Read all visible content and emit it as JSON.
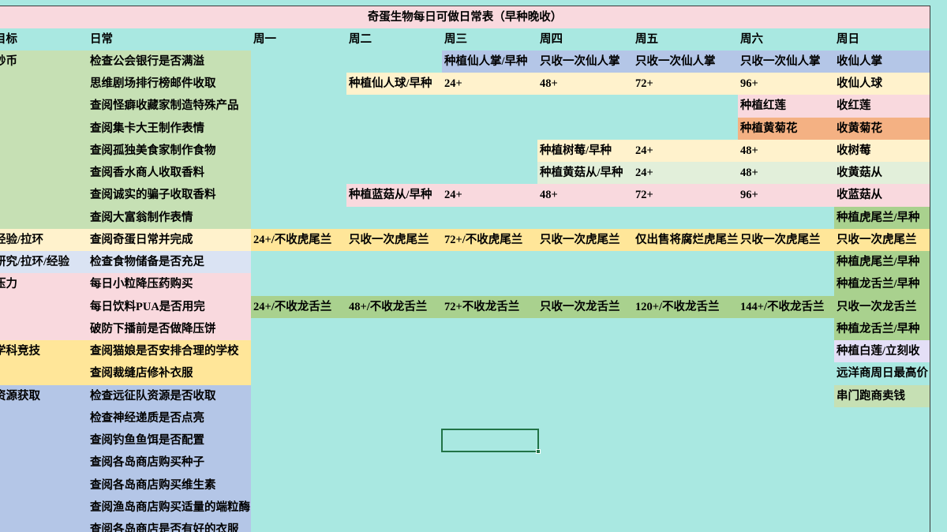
{
  "sheet": {
    "title": "奇蛋生物每日可做日常表（早种晚收）",
    "columns": {
      "goal": "目标",
      "task": "日常",
      "days": [
        "周一",
        "周二",
        "周三",
        "周四",
        "周五",
        "周六",
        "周日"
      ]
    },
    "colors": {
      "background": "#a9e8e1",
      "title_fill": "#f9d9de",
      "border": "#3a3a3a",
      "selection": "#217346"
    },
    "groups": [
      {
        "goal": "钞币",
        "fill": "#c6e0b4",
        "rows": [
          {
            "task": "检查公会银行是否满溢",
            "days": [
              null,
              null,
              {
                "text": "种植仙人掌/早种",
                "fill": "#b4c6e7"
              },
              {
                "text": "只收一次仙人掌",
                "fill": "#b4c6e7"
              },
              {
                "text": "只收一次仙人掌",
                "fill": "#b4c6e7"
              },
              {
                "text": "只收一次仙人掌",
                "fill": "#b4c6e7"
              },
              {
                "text": "收仙人掌",
                "fill": "#b4c6e7"
              }
            ]
          },
          {
            "task": "思维剧场排行榜邮件收取",
            "days": [
              null,
              {
                "text": "种植仙人球/早种",
                "fill": "#fff2cc"
              },
              {
                "text": "24+",
                "fill": "#fff2cc"
              },
              {
                "text": "48+",
                "fill": "#fff2cc"
              },
              {
                "text": "72+",
                "fill": "#fff2cc"
              },
              {
                "text": "96+",
                "fill": "#fff2cc"
              },
              {
                "text": "收仙人球",
                "fill": "#fff2cc"
              }
            ]
          },
          {
            "task": "查阅怪癖收藏家制造特殊产品",
            "days": [
              null,
              null,
              null,
              null,
              null,
              {
                "text": "种植红莲",
                "fill": "#f9d9de"
              },
              {
                "text": "收红莲",
                "fill": "#f9d9de"
              }
            ]
          },
          {
            "task": "查阅集卡大王制作表情",
            "days": [
              null,
              null,
              null,
              null,
              null,
              {
                "text": "种植黄菊花",
                "fill": "#f4b183"
              },
              {
                "text": "收黄菊花",
                "fill": "#f4b183"
              }
            ]
          },
          {
            "task": "查阅孤独美食家制作食物",
            "days": [
              null,
              null,
              null,
              {
                "text": "种植树莓/早种",
                "fill": "#fff2cc"
              },
              {
                "text": "24+",
                "fill": "#fff2cc"
              },
              {
                "text": "48+",
                "fill": "#fff2cc"
              },
              {
                "text": "收树莓",
                "fill": "#fff2cc"
              }
            ]
          },
          {
            "task": "查阅香水商人收取香料",
            "days": [
              null,
              null,
              null,
              {
                "text": "种植黄菇从/早种",
                "fill": "#e2efda"
              },
              {
                "text": "24+",
                "fill": "#e2efda"
              },
              {
                "text": "48+",
                "fill": "#e2efda"
              },
              {
                "text": "收黄菇从",
                "fill": "#e2efda"
              }
            ]
          },
          {
            "task": "查阅诚实的骗子收取香料",
            "days": [
              null,
              {
                "text": "种植蓝菇从/早种",
                "fill": "#f9d9de"
              },
              {
                "text": "24+",
                "fill": "#f9d9de"
              },
              {
                "text": "48+",
                "fill": "#f9d9de"
              },
              {
                "text": "72+",
                "fill": "#f9d9de"
              },
              {
                "text": "96+",
                "fill": "#f9d9de"
              },
              {
                "text": "收蓝菇从",
                "fill": "#f9d9de"
              }
            ]
          },
          {
            "task": "查阅大富翁制作表情",
            "days": [
              null,
              null,
              null,
              null,
              null,
              null,
              {
                "text": "种植虎尾兰/早种",
                "fill": "#a9d18e"
              }
            ]
          }
        ]
      },
      {
        "goal": "经验/拉环",
        "fill": "#fff2cc",
        "rows": [
          {
            "task": "查阅奇蛋日常并完成",
            "days": [
              {
                "text": "24+/不收虎尾兰",
                "fill": "#ffe699"
              },
              {
                "text": "只收一次虎尾兰",
                "fill": "#ffe699"
              },
              {
                "text": "72+/不收虎尾兰",
                "fill": "#ffe699"
              },
              {
                "text": "只收一次虎尾兰",
                "fill": "#ffe699"
              },
              {
                "text": "仅出售将腐烂虎尾兰",
                "fill": "#ffe699"
              },
              {
                "text": "只收一次虎尾兰",
                "fill": "#ffe699"
              },
              {
                "text": "只收一次虎尾兰",
                "fill": "#ffe699"
              }
            ]
          }
        ]
      },
      {
        "goal": "研究/拉环/经验",
        "fill": "#dae3f3",
        "rows": [
          {
            "task": "检查食物储备是否充足",
            "days": [
              null,
              null,
              null,
              null,
              null,
              null,
              {
                "text": "种植虎尾兰/早种",
                "fill": "#a9d18e"
              }
            ]
          }
        ]
      },
      {
        "goal": "压力",
        "fill": "#f9d9de",
        "rows": [
          {
            "task": "每日小粒降压药购买",
            "days": [
              null,
              null,
              null,
              null,
              null,
              null,
              {
                "text": "种植龙舌兰/早种",
                "fill": "#a9d18e"
              }
            ]
          },
          {
            "task": "每日饮料PUA是否用完",
            "days": [
              {
                "text": "24+/不收龙舌兰",
                "fill": "#a9d18e"
              },
              {
                "text": "48+/不收龙舌兰",
                "fill": "#a9d18e"
              },
              {
                "text": "72+不收龙舌兰",
                "fill": "#a9d18e"
              },
              {
                "text": "只收一次龙舌兰",
                "fill": "#a9d18e"
              },
              {
                "text": "120+/不收龙舌兰",
                "fill": "#a9d18e"
              },
              {
                "text": "144+/不收龙舌兰",
                "fill": "#a9d18e"
              },
              {
                "text": "只收一次龙舌兰",
                "fill": "#a9d18e"
              }
            ]
          },
          {
            "task": "破防下播前是否做降压饼",
            "days": [
              null,
              null,
              null,
              null,
              null,
              null,
              {
                "text": "种植龙舌兰/早种",
                "fill": "#a9d18e"
              }
            ]
          }
        ]
      },
      {
        "goal": "学科竞技",
        "fill": "#ffe699",
        "rows": [
          {
            "task": "查阅猫娘是否安排合理的学校",
            "days": [
              null,
              null,
              null,
              null,
              null,
              null,
              {
                "text": "种植白莲/立刻收",
                "fill": "#e4dff6"
              }
            ]
          },
          {
            "task": "查阅裁缝店修补衣服",
            "days": [
              null,
              null,
              null,
              null,
              null,
              null,
              {
                "text": "远洋商周日最高价",
                "fill": null
              }
            ]
          }
        ]
      },
      {
        "goal": "资源获取",
        "fill": "#b4c6e7",
        "rows": [
          {
            "task": "检查远征队资源是否收取",
            "days": [
              null,
              null,
              null,
              null,
              null,
              null,
              {
                "text": "串门跑商卖钱",
                "fill": "#c6e0b4"
              }
            ]
          },
          {
            "task": "检查神经递质是否点亮",
            "days": [
              null,
              null,
              null,
              null,
              null,
              null,
              null
            ]
          },
          {
            "task": "查阅钓鱼鱼饵是否配置",
            "days": [
              null,
              null,
              null,
              null,
              null,
              null,
              null
            ]
          },
          {
            "task": "查阅各岛商店购买种子",
            "days": [
              null,
              null,
              null,
              null,
              null,
              null,
              null
            ]
          },
          {
            "task": "查阅各岛商店购买维生素",
            "days": [
              null,
              null,
              null,
              null,
              null,
              null,
              null
            ]
          },
          {
            "task": "查阅渔岛商店购买适量的端粒酶",
            "days": [
              null,
              null,
              null,
              null,
              null,
              null,
              null
            ]
          },
          {
            "task": "查阅各岛商店是否有好的衣服",
            "days": [
              null,
              null,
              null,
              null,
              null,
              null,
              null
            ]
          }
        ]
      }
    ]
  }
}
